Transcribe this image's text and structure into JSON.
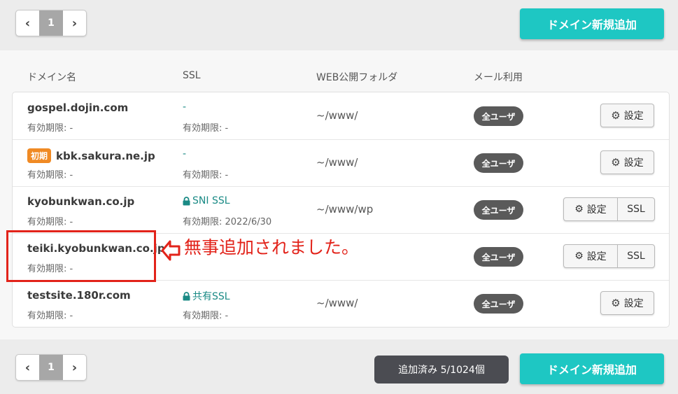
{
  "pagination": {
    "prev": "‹",
    "page": "1",
    "next": "›"
  },
  "actions": {
    "add_domain": "ドメイン新規追加",
    "count": "追加済み 5/1024個"
  },
  "columns": {
    "domain": "ドメイン名",
    "ssl": "SSL",
    "folder": "WEB公開フォルダ",
    "mail": "メール利用"
  },
  "rows": [
    {
      "domain": "gospel.dojin.com",
      "tag": "",
      "expiry": "有効期限: -",
      "ssl": "-",
      "ssl_expiry": "有効期限: -",
      "folder": "~/www/",
      "mail": "全ユーザ",
      "settings": "設定",
      "ssl_button": ""
    },
    {
      "domain": "kbk.sakura.ne.jp",
      "tag": "初期",
      "expiry": "有効期限: -",
      "ssl": "-",
      "ssl_expiry": "有効期限: -",
      "folder": "~/www/",
      "mail": "全ユーザ",
      "settings": "設定",
      "ssl_button": ""
    },
    {
      "domain": "kyobunkwan.co.jp",
      "tag": "",
      "expiry": "有効期限: -",
      "ssl": "SNI SSL",
      "ssl_expiry": "有効期限: 2022/6/30",
      "folder": "~/www/wp",
      "mail": "全ユーザ",
      "settings": "設定",
      "ssl_button": "SSL"
    },
    {
      "domain": "teiki.kyobunkwan.co.jp",
      "tag": "",
      "expiry": "有効期限: -",
      "ssl": "",
      "ssl_expiry": "",
      "folder": "",
      "mail": "全ユーザ",
      "settings": "設定",
      "ssl_button": "SSL"
    },
    {
      "domain": "testsite.180r.com",
      "tag": "",
      "expiry": "有効期限: -",
      "ssl": "共有SSL",
      "ssl_expiry": "有効期限: -",
      "folder": "~/www/",
      "mail": "全ユーザ",
      "settings": "設定",
      "ssl_button": ""
    }
  ],
  "annotation": {
    "text": "無事追加されました。"
  },
  "colors": {
    "accent": "#1ec7c3",
    "annotation": "#e2231a",
    "tag": "#f08a24",
    "ssl_link": "#1a8a85"
  }
}
